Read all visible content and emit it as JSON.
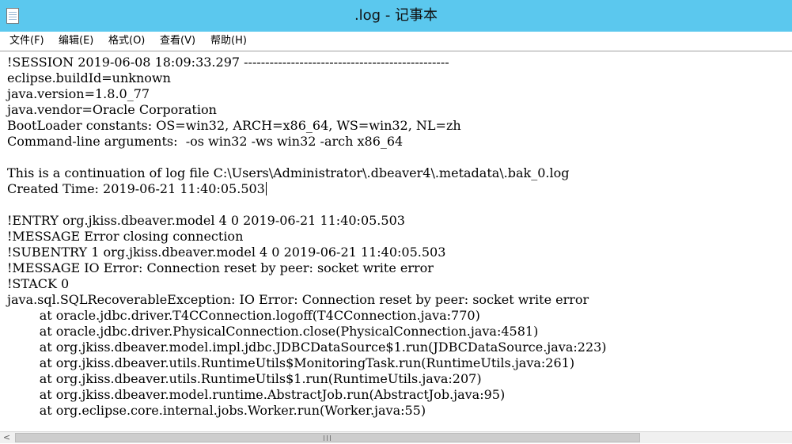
{
  "window": {
    "title": ".log - 记事本",
    "icon": "notepad-icon"
  },
  "menu": {
    "items": [
      {
        "label": "文件(F)"
      },
      {
        "label": "编辑(E)"
      },
      {
        "label": "格式(O)"
      },
      {
        "label": "查看(V)"
      },
      {
        "label": "帮助(H)"
      }
    ]
  },
  "editor": {
    "lines": [
      "!SESSION 2019-06-08 18:09:33.297 ------------------------------------------------",
      "eclipse.buildId=unknown",
      "java.version=1.8.0_77",
      "java.vendor=Oracle Corporation",
      "BootLoader constants: OS=win32, ARCH=x86_64, WS=win32, NL=zh",
      "Command-line arguments:  -os win32 -ws win32 -arch x86_64",
      "",
      "This is a continuation of log file C:\\Users\\Administrator\\.dbeaver4\\.metadata\\.bak_0.log",
      "Created Time: 2019-06-21 11:40:05.503",
      "",
      "!ENTRY org.jkiss.dbeaver.model 4 0 2019-06-21 11:40:05.503",
      "!MESSAGE Error closing connection",
      "!SUBENTRY 1 org.jkiss.dbeaver.model 4 0 2019-06-21 11:40:05.503",
      "!MESSAGE IO Error: Connection reset by peer: socket write error",
      "!STACK 0",
      "java.sql.SQLRecoverableException: IO Error: Connection reset by peer: socket write error",
      "        at oracle.jdbc.driver.T4CConnection.logoff(T4CConnection.java:770)",
      "        at oracle.jdbc.driver.PhysicalConnection.close(PhysicalConnection.java:4581)",
      "        at org.jkiss.dbeaver.model.impl.jdbc.JDBCDataSource$1.run(JDBCDataSource.java:223)",
      "        at org.jkiss.dbeaver.utils.RuntimeUtils$MonitoringTask.run(RuntimeUtils.java:261)",
      "        at org.jkiss.dbeaver.utils.RuntimeUtils$1.run(RuntimeUtils.java:207)",
      "        at org.jkiss.dbeaver.model.runtime.AbstractJob.run(AbstractJob.java:95)",
      "        at org.eclipse.core.internal.jobs.Worker.run(Worker.java:55)"
    ]
  },
  "scrollbar": {
    "left_arrow": "<",
    "thumb_grip": "grip-icon"
  }
}
